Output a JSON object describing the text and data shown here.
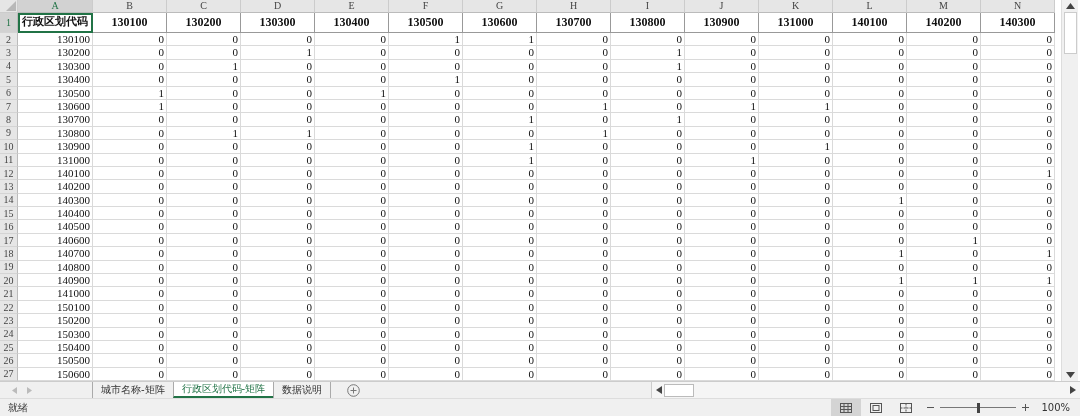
{
  "columns": [
    "A",
    "B",
    "C",
    "D",
    "E",
    "F",
    "G",
    "H",
    "I",
    "J",
    "K",
    "L",
    "M",
    "N"
  ],
  "header_row": {
    "row_number": "1",
    "cells": [
      {
        "text": "行政区划代码",
        "selected": true
      },
      {
        "text": "130100",
        "selected": false
      },
      {
        "text": "130200",
        "selected": false
      },
      {
        "text": "130300",
        "selected": false
      },
      {
        "text": "130400",
        "selected": false
      },
      {
        "text": "130500",
        "selected": false
      },
      {
        "text": "130600",
        "selected": false
      },
      {
        "text": "130700",
        "selected": false
      },
      {
        "text": "130800",
        "selected": false
      },
      {
        "text": "130900",
        "selected": false
      },
      {
        "text": "131000",
        "selected": false
      },
      {
        "text": "140100",
        "selected": false
      },
      {
        "text": "140200",
        "selected": false
      },
      {
        "text": "140300",
        "selected": false
      }
    ]
  },
  "rows": [
    {
      "row_number": "2",
      "cells": [
        "130100",
        "0",
        "0",
        "0",
        "0",
        "1",
        "1",
        "0",
        "0",
        "0",
        "0",
        "0",
        "0",
        "0"
      ]
    },
    {
      "row_number": "3",
      "cells": [
        "130200",
        "0",
        "0",
        "1",
        "0",
        "0",
        "0",
        "0",
        "1",
        "0",
        "0",
        "0",
        "0",
        "0"
      ]
    },
    {
      "row_number": "4",
      "cells": [
        "130300",
        "0",
        "1",
        "0",
        "0",
        "0",
        "0",
        "0",
        "1",
        "0",
        "0",
        "0",
        "0",
        "0"
      ]
    },
    {
      "row_number": "5",
      "cells": [
        "130400",
        "0",
        "0",
        "0",
        "0",
        "1",
        "0",
        "0",
        "0",
        "0",
        "0",
        "0",
        "0",
        "0"
      ]
    },
    {
      "row_number": "6",
      "cells": [
        "130500",
        "1",
        "0",
        "0",
        "1",
        "0",
        "0",
        "0",
        "0",
        "0",
        "0",
        "0",
        "0",
        "0"
      ]
    },
    {
      "row_number": "7",
      "cells": [
        "130600",
        "1",
        "0",
        "0",
        "0",
        "0",
        "0",
        "1",
        "0",
        "1",
        "1",
        "0",
        "0",
        "0"
      ]
    },
    {
      "row_number": "8",
      "cells": [
        "130700",
        "0",
        "0",
        "0",
        "0",
        "0",
        "1",
        "0",
        "1",
        "0",
        "0",
        "0",
        "0",
        "0"
      ]
    },
    {
      "row_number": "9",
      "cells": [
        "130800",
        "0",
        "1",
        "1",
        "0",
        "0",
        "0",
        "1",
        "0",
        "0",
        "0",
        "0",
        "0",
        "0"
      ]
    },
    {
      "row_number": "10",
      "cells": [
        "130900",
        "0",
        "0",
        "0",
        "0",
        "0",
        "1",
        "0",
        "0",
        "0",
        "1",
        "0",
        "0",
        "0"
      ]
    },
    {
      "row_number": "11",
      "cells": [
        "131000",
        "0",
        "0",
        "0",
        "0",
        "0",
        "1",
        "0",
        "0",
        "1",
        "0",
        "0",
        "0",
        "0"
      ]
    },
    {
      "row_number": "12",
      "cells": [
        "140100",
        "0",
        "0",
        "0",
        "0",
        "0",
        "0",
        "0",
        "0",
        "0",
        "0",
        "0",
        "0",
        "1"
      ]
    },
    {
      "row_number": "13",
      "cells": [
        "140200",
        "0",
        "0",
        "0",
        "0",
        "0",
        "0",
        "0",
        "0",
        "0",
        "0",
        "0",
        "0",
        "0"
      ]
    },
    {
      "row_number": "14",
      "cells": [
        "140300",
        "0",
        "0",
        "0",
        "0",
        "0",
        "0",
        "0",
        "0",
        "0",
        "0",
        "1",
        "0",
        "0"
      ]
    },
    {
      "row_number": "15",
      "cells": [
        "140400",
        "0",
        "0",
        "0",
        "0",
        "0",
        "0",
        "0",
        "0",
        "0",
        "0",
        "0",
        "0",
        "0"
      ]
    },
    {
      "row_number": "16",
      "cells": [
        "140500",
        "0",
        "0",
        "0",
        "0",
        "0",
        "0",
        "0",
        "0",
        "0",
        "0",
        "0",
        "0",
        "0"
      ]
    },
    {
      "row_number": "17",
      "cells": [
        "140600",
        "0",
        "0",
        "0",
        "0",
        "0",
        "0",
        "0",
        "0",
        "0",
        "0",
        "0",
        "1",
        "0"
      ]
    },
    {
      "row_number": "18",
      "cells": [
        "140700",
        "0",
        "0",
        "0",
        "0",
        "0",
        "0",
        "0",
        "0",
        "0",
        "0",
        "1",
        "0",
        "1"
      ]
    },
    {
      "row_number": "19",
      "cells": [
        "140800",
        "0",
        "0",
        "0",
        "0",
        "0",
        "0",
        "0",
        "0",
        "0",
        "0",
        "0",
        "0",
        "0"
      ]
    },
    {
      "row_number": "20",
      "cells": [
        "140900",
        "0",
        "0",
        "0",
        "0",
        "0",
        "0",
        "0",
        "0",
        "0",
        "0",
        "1",
        "1",
        "1"
      ]
    },
    {
      "row_number": "21",
      "cells": [
        "141000",
        "0",
        "0",
        "0",
        "0",
        "0",
        "0",
        "0",
        "0",
        "0",
        "0",
        "0",
        "0",
        "0"
      ]
    },
    {
      "row_number": "22",
      "cells": [
        "150100",
        "0",
        "0",
        "0",
        "0",
        "0",
        "0",
        "0",
        "0",
        "0",
        "0",
        "0",
        "0",
        "0"
      ]
    },
    {
      "row_number": "23",
      "cells": [
        "150200",
        "0",
        "0",
        "0",
        "0",
        "0",
        "0",
        "0",
        "0",
        "0",
        "0",
        "0",
        "0",
        "0"
      ]
    },
    {
      "row_number": "24",
      "cells": [
        "150300",
        "0",
        "0",
        "0",
        "0",
        "0",
        "0",
        "0",
        "0",
        "0",
        "0",
        "0",
        "0",
        "0"
      ]
    },
    {
      "row_number": "25",
      "cells": [
        "150400",
        "0",
        "0",
        "0",
        "0",
        "0",
        "0",
        "0",
        "0",
        "0",
        "0",
        "0",
        "0",
        "0"
      ]
    },
    {
      "row_number": "26",
      "cells": [
        "150500",
        "0",
        "0",
        "0",
        "0",
        "0",
        "0",
        "0",
        "0",
        "0",
        "0",
        "0",
        "0",
        "0"
      ]
    },
    {
      "row_number": "27",
      "cells": [
        "150600",
        "0",
        "0",
        "0",
        "0",
        "0",
        "0",
        "0",
        "0",
        "0",
        "0",
        "0",
        "0",
        "0"
      ]
    }
  ],
  "sheet_tabs": [
    {
      "label": "城市名称-矩阵",
      "selected": false
    },
    {
      "label": "行政区划代码-矩阵",
      "selected": true
    },
    {
      "label": "数据说明",
      "selected": false
    }
  ],
  "status_bar": {
    "status": "就绪",
    "views": [
      {
        "kind": "normal",
        "selected": true
      },
      {
        "kind": "page-layout",
        "selected": false
      },
      {
        "kind": "page-break",
        "selected": false
      }
    ],
    "zoom": {
      "level": 0.5,
      "reading": "100%"
    }
  }
}
